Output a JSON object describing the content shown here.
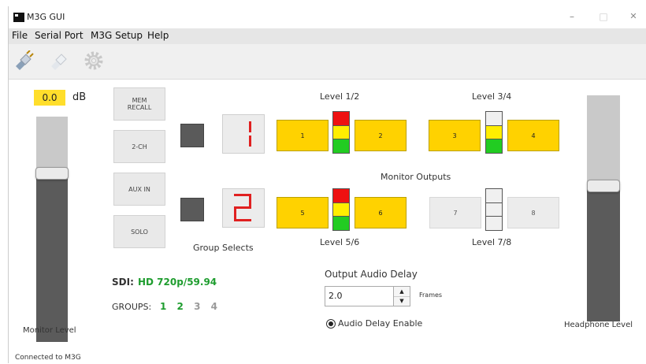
{
  "window": {
    "title": "M3G GUI",
    "minimize": "–",
    "maximize": "□",
    "close": "✕"
  },
  "menubar": [
    "File",
    "Serial Port",
    "M3G Setup",
    "Help"
  ],
  "toolbar": {
    "icons": [
      "connect-plug-icon",
      "disconnect-plug-icon",
      "settings-gear-icon"
    ]
  },
  "monitor": {
    "level_value": "0.0",
    "unit": "dB",
    "label": "Monitor Level",
    "level_fraction": 0.75
  },
  "side_buttons": [
    "MEM\nRECALL",
    "2-CH",
    "AUX IN",
    "SOLO"
  ],
  "group_selects": {
    "label": "Group Selects",
    "digit_top": "1",
    "digit_bottom": "2"
  },
  "levels": {
    "l12": "Level 1/2",
    "l34": "Level 3/4",
    "l56": "Level 5/6",
    "l78": "Level 7/8"
  },
  "monitor_outputs_label": "Monitor Outputs",
  "channels": [
    {
      "label": "1",
      "on": true
    },
    {
      "label": "2",
      "on": true
    },
    {
      "label": "3",
      "on": true
    },
    {
      "label": "4",
      "on": true
    },
    {
      "label": "5",
      "on": true
    },
    {
      "label": "6",
      "on": true
    },
    {
      "label": "7",
      "on": false
    },
    {
      "label": "8",
      "on": false
    }
  ],
  "meter_colors": {
    "red": "#ee1111",
    "yellow": "#ffee00",
    "green": "#22cc22",
    "off": "#f0f0f0"
  },
  "sdi": {
    "label": "SDI:",
    "value": "HD 720p/59.94"
  },
  "groups": {
    "label": "GROUPS:",
    "items": [
      "1",
      "2",
      "3",
      "4"
    ],
    "active": [
      "1",
      "2"
    ]
  },
  "audio_delay": {
    "label": "Output Audio Delay",
    "value": "2.0",
    "unit": "Frames",
    "enable_label": "Audio Delay Enable",
    "enabled": true
  },
  "headphone": {
    "label": "Headphone Level",
    "level_fraction": 0.6
  },
  "status": "Connected to M3G"
}
